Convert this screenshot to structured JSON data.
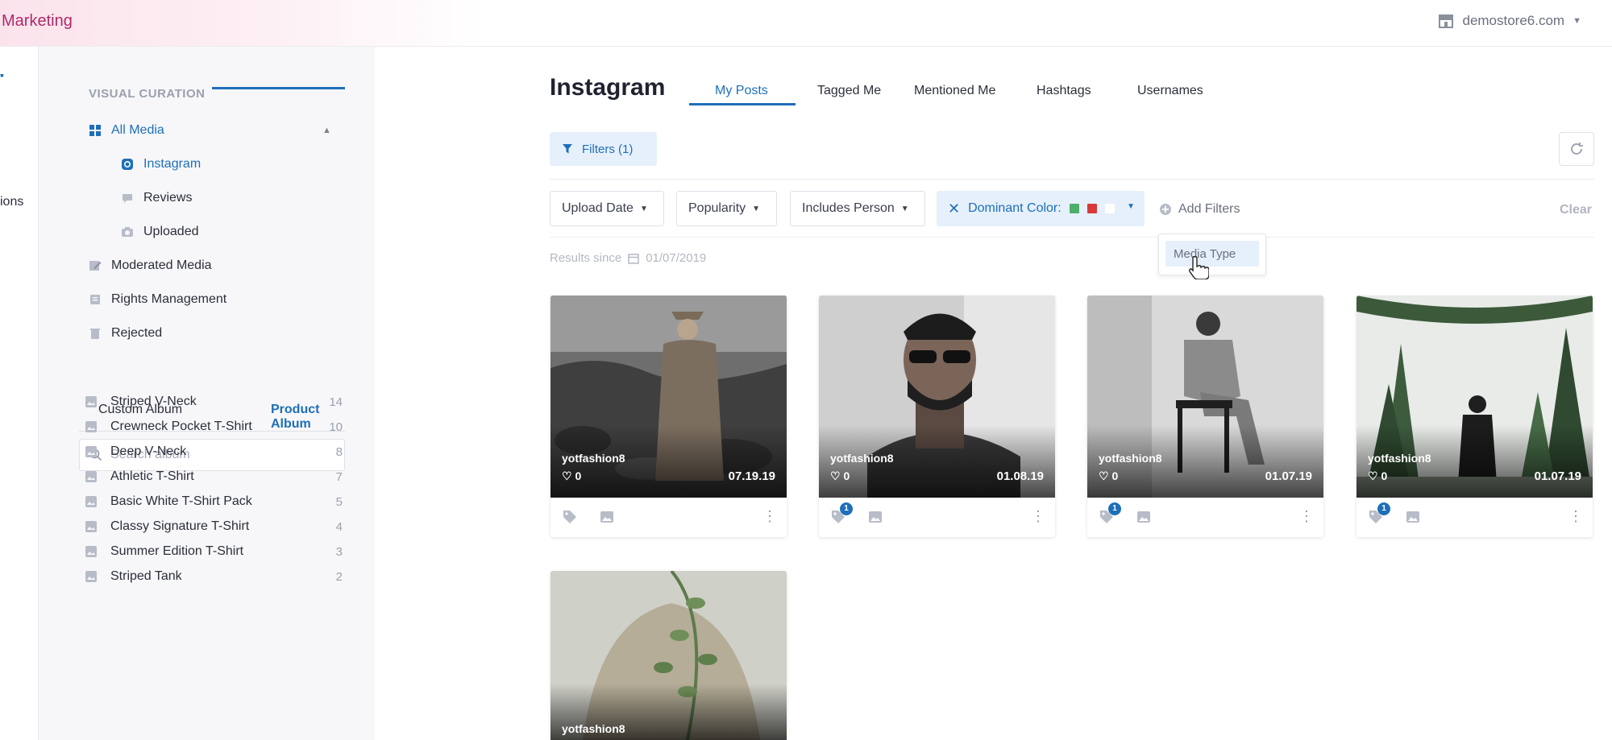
{
  "header": {
    "brand": "Marketing",
    "store": "demostore6.com"
  },
  "rail": {
    "label": "ions"
  },
  "sidebar": {
    "section_title": "VISUAL CURATION",
    "items": [
      {
        "label": "All Media",
        "icon": "grid-icon"
      },
      {
        "label": "Instagram",
        "icon": "instagram-icon"
      },
      {
        "label": "Reviews",
        "icon": "chat-bubble-icon"
      },
      {
        "label": "Uploaded",
        "icon": "camera-icon"
      },
      {
        "label": "Moderated Media",
        "icon": "edit-icon"
      },
      {
        "label": "Rights Management",
        "icon": "book-icon"
      },
      {
        "label": "Rejected",
        "icon": "trash-icon"
      }
    ],
    "album_tabs": [
      "Custom Album",
      "Product Album"
    ],
    "search_placeholder": "Search album",
    "albums": [
      {
        "name": "Striped V-Neck",
        "count": "14"
      },
      {
        "name": "Crewneck Pocket T-Shirt",
        "count": "10"
      },
      {
        "name": "Deep V-Neck",
        "count": "8"
      },
      {
        "name": "Athletic T-Shirt",
        "count": "7"
      },
      {
        "name": "Basic White T-Shirt Pack",
        "count": "5"
      },
      {
        "name": "Classy Signature T-Shirt",
        "count": "4"
      },
      {
        "name": "Summer Edition T-Shirt",
        "count": "3"
      },
      {
        "name": "Striped Tank",
        "count": "2"
      }
    ]
  },
  "main": {
    "title": "Instagram",
    "tabs": [
      "My Posts",
      "Tagged Me",
      "Mentioned Me",
      "Hashtags",
      "Usernames"
    ],
    "active_tab": "My Posts",
    "filters_button": "Filters (1)",
    "filter_chips": [
      "Upload Date",
      "Popularity",
      "Includes Person"
    ],
    "dominant_color": {
      "label": "Dominant Color:",
      "swatches": [
        "#4caf6a",
        "#d83a3a",
        "#ffffff"
      ]
    },
    "add_filters": "Add Filters",
    "clear": "Clear",
    "dropdown_option": "Media Type",
    "results_since_label": "Results since",
    "results_since_date": "01/07/2019"
  },
  "posts": [
    {
      "user": "yotfashion8",
      "likes": "0",
      "date": "07.19.19",
      "badge": ""
    },
    {
      "user": "yotfashion8",
      "likes": "0",
      "date": "01.08.19",
      "badge": "1"
    },
    {
      "user": "yotfashion8",
      "likes": "0",
      "date": "01.07.19",
      "badge": "1"
    },
    {
      "user": "yotfashion8",
      "likes": "0",
      "date": "01.07.19",
      "badge": "1"
    },
    {
      "user": "yotfashion8"
    }
  ],
  "colors": {
    "accent": "#1e6fb8",
    "brand": "#b0296b",
    "accent_light": "#e6f0fb"
  }
}
